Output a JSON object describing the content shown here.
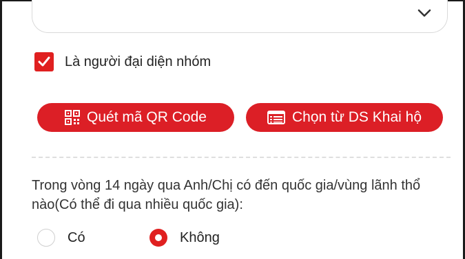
{
  "dropdown": {
    "icon": "chevron-down-icon"
  },
  "group_rep": {
    "label": "Là người đại diện nhóm",
    "checked": true,
    "icon": "checkmark-icon"
  },
  "buttons": {
    "scan_qr": {
      "label": "Quét mã QR Code",
      "icon": "qr-code-icon"
    },
    "choose_list": {
      "label": "Chọn từ DS Khai hộ",
      "icon": "list-icon"
    }
  },
  "question": {
    "text": "Trong vòng 14 ngày qua Anh/Chị có đến quốc gia/vùng lãnh thổ nào(Có thể đi qua nhiều quốc gia):",
    "options": [
      {
        "label": "Có",
        "selected": false
      },
      {
        "label": "Không",
        "selected": true
      }
    ]
  },
  "colors": {
    "accent": "#dc1f26",
    "border": "#d9d9d9",
    "text": "#222222"
  }
}
